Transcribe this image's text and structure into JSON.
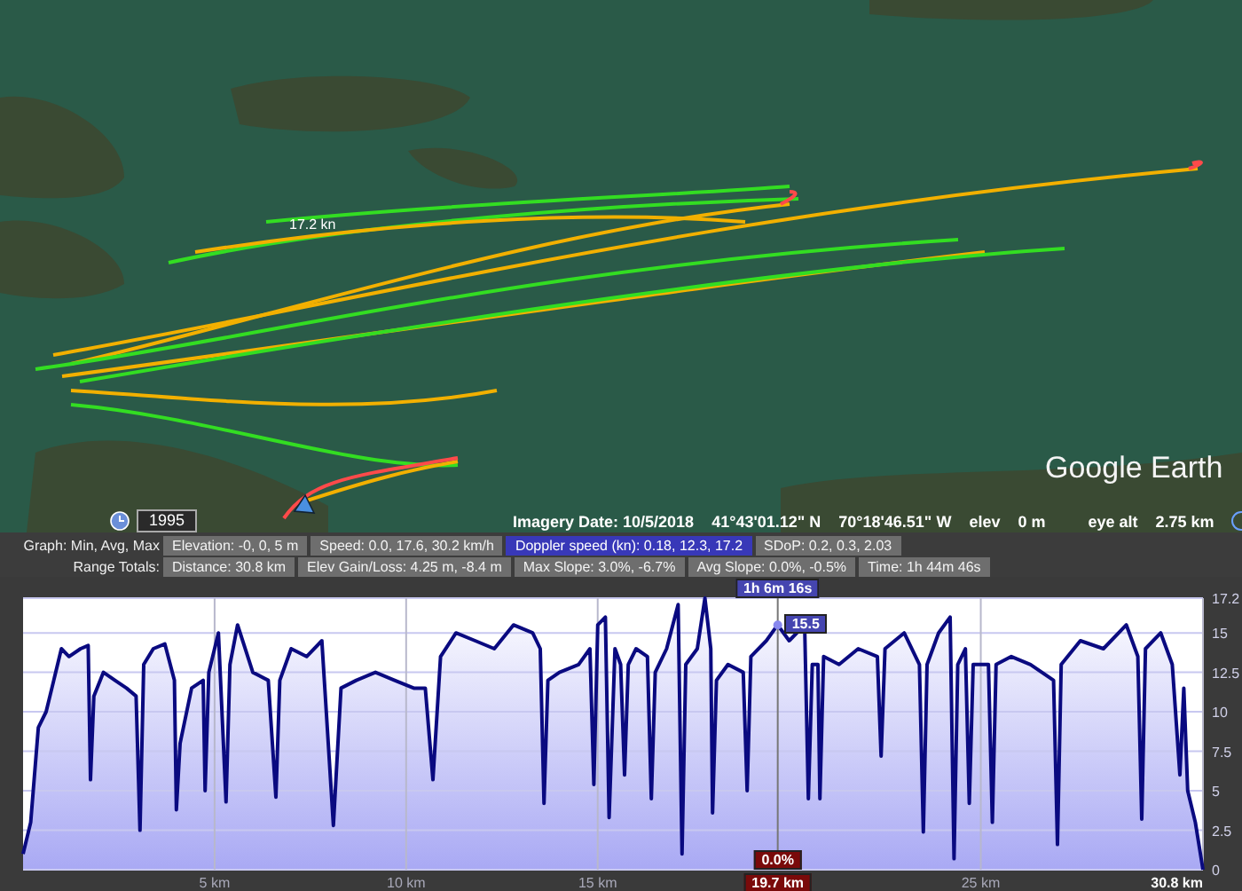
{
  "map": {
    "track_label": "17.2 kn",
    "logo": "Google Earth"
  },
  "map_status": {
    "year": "1995",
    "imagery_date": "Imagery Date: 10/5/2018",
    "latitude": "41°43'01.12\" N",
    "longitude": "70°18'46.51\" W",
    "elev_label": "elev",
    "elev": "0 m",
    "eye_alt_label": "eye alt",
    "eye_alt": "2.75 km"
  },
  "graph_bar": {
    "label": "Graph: Min, Avg, Max",
    "items": [
      {
        "text": "Elevation: -0, 0, 5 m",
        "selected": false
      },
      {
        "text": "Speed: 0.0, 17.6, 30.2 km/h",
        "selected": false
      },
      {
        "text": "Doppler speed (kn): 0.18, 12.3, 17.2",
        "selected": true
      },
      {
        "text": "SDoP: 0.2, 0.3, 2.03",
        "selected": false
      }
    ]
  },
  "range_totals": {
    "label": "Range Totals:",
    "items": [
      "Distance: 30.8 km",
      "Elev Gain/Loss: 4.25 m, -8.4 m",
      "Max Slope: 3.0%, -6.7%",
      "Avg Slope: 0.0%, -0.5%",
      "Time: 1h 44m 46s"
    ]
  },
  "profile": {
    "chart_data": {
      "type": "area",
      "xlim": [
        0,
        30.8
      ],
      "ylim": [
        0,
        17.2
      ],
      "xticks": [
        {
          "value": 5,
          "label": "5 km"
        },
        {
          "value": 10,
          "label": "10 km"
        },
        {
          "value": 15,
          "label": "15 km"
        },
        {
          "value": 25,
          "label": "25 km"
        },
        {
          "value": 30.8,
          "label": "30.8 km"
        }
      ],
      "yticks": [
        0,
        2.5,
        5,
        7.5,
        10,
        12.5,
        15,
        17.2
      ],
      "x": [
        0,
        0.2,
        0.4,
        0.6,
        0.8,
        1.0,
        1.2,
        1.5,
        1.7,
        1.76,
        1.85,
        2.1,
        2.4,
        2.7,
        2.95,
        3.05,
        3.15,
        3.4,
        3.7,
        3.95,
        4.0,
        4.1,
        4.4,
        4.7,
        4.75,
        4.85,
        5.1,
        5.3,
        5.4,
        5.6,
        6.0,
        6.4,
        6.6,
        6.7,
        7.0,
        7.4,
        7.8,
        8.1,
        8.3,
        8.7,
        9.2,
        9.7,
        10.2,
        10.5,
        10.7,
        10.9,
        11.3,
        11.8,
        12.3,
        12.8,
        13.3,
        13.5,
        13.6,
        13.7,
        14.0,
        14.5,
        14.8,
        14.9,
        15.0,
        15.2,
        15.3,
        15.45,
        15.6,
        15.7,
        15.8,
        16.0,
        16.3,
        16.4,
        16.5,
        16.8,
        17.1,
        17.2,
        17.3,
        17.6,
        17.8,
        17.95,
        18.0,
        18.1,
        18.4,
        18.8,
        18.9,
        19.0,
        19.4,
        19.7,
        20.0,
        20.4,
        20.5,
        20.6,
        20.75,
        20.8,
        20.9,
        21.3,
        21.8,
        22.3,
        22.4,
        22.5,
        23.0,
        23.4,
        23.5,
        23.6,
        23.9,
        24.2,
        24.3,
        24.4,
        24.6,
        24.7,
        24.8,
        25.2,
        25.3,
        25.4,
        25.8,
        26.3,
        26.9,
        27.0,
        27.1,
        27.6,
        28.2,
        28.8,
        29.1,
        29.2,
        29.3,
        29.7,
        30.0,
        30.2,
        30.3,
        30.4,
        30.6,
        30.8
      ],
      "series": [
        {
          "color": "#0a0a80",
          "values": [
            1,
            3,
            9,
            10,
            12,
            14,
            13.5,
            14,
            14.2,
            5.7,
            11,
            12.5,
            12,
            11.5,
            11,
            2.5,
            13,
            14,
            14.3,
            12,
            3.8,
            8,
            11.5,
            12,
            5,
            12.5,
            15,
            4.3,
            13,
            15.5,
            12.5,
            12,
            4.6,
            12,
            14,
            13.5,
            14.5,
            2.8,
            11.5,
            12,
            12.5,
            12,
            11.5,
            11.5,
            5.7,
            13.5,
            15,
            14.5,
            14,
            15.5,
            15,
            14,
            4.2,
            12,
            12.5,
            13,
            14,
            5.4,
            15.5,
            16,
            3.3,
            14,
            13,
            6,
            13,
            14,
            13.5,
            4.5,
            12.5,
            14,
            16.8,
            1.0,
            13,
            14,
            17.2,
            14,
            3.6,
            12,
            13,
            12.5,
            5,
            13.5,
            14.5,
            15.5,
            14.5,
            15.5,
            4.5,
            13,
            13,
            4.5,
            13.5,
            13,
            14,
            13.5,
            7.2,
            14,
            15,
            13,
            2.4,
            13,
            15,
            16,
            0.7,
            13,
            14,
            4.2,
            13,
            13,
            3,
            13,
            13.5,
            13,
            12,
            1.6,
            13,
            14.5,
            14,
            15.5,
            13.5,
            3.2,
            14,
            15,
            13,
            6,
            11.5,
            5,
            3,
            0
          ]
        }
      ],
      "grid": true,
      "ref_lines": [
        {
          "axis": "x",
          "value": 19.7,
          "label": "19.7 km"
        }
      ],
      "annotations": [
        {
          "x": 19.7,
          "y": 15.5,
          "text": "15.5"
        }
      ]
    },
    "cursor": {
      "time": "1h 6m 16s",
      "slope": "0.0%"
    }
  }
}
